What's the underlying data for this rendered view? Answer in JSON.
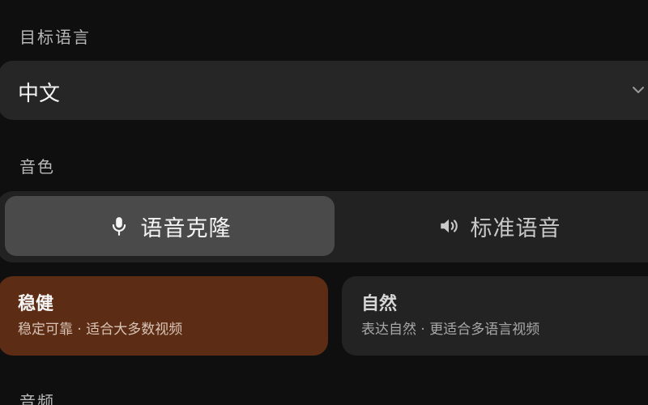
{
  "target_language": {
    "label": "目标语言",
    "value": "中文"
  },
  "voice": {
    "label": "音色",
    "segments": [
      {
        "label": "语音克隆",
        "icon": "microphone-icon",
        "selected": true
      },
      {
        "label": "标准语音",
        "icon": "speaker-icon",
        "selected": false
      }
    ],
    "styles": [
      {
        "title": "稳健",
        "description": "稳定可靠 · 适合大多数视频",
        "selected": true
      },
      {
        "title": "自然",
        "description": "表达自然 · 更适合多语言视频",
        "selected": false
      }
    ]
  },
  "audio": {
    "label": "音频"
  },
  "colors": {
    "background": "#0f0f0f",
    "field": "#262626",
    "selected_segment": "#4a4a4a",
    "selected_card": "#5c2d14"
  }
}
